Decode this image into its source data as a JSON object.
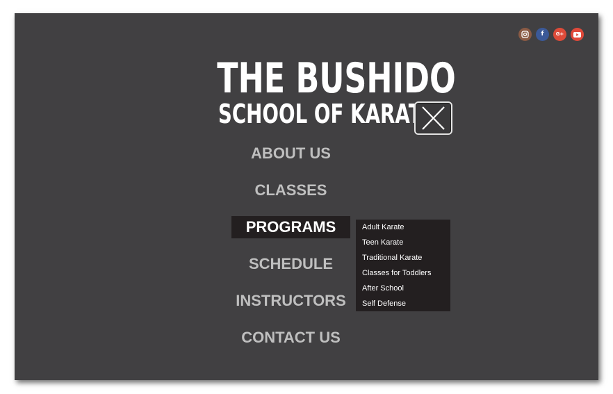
{
  "logo": {
    "line1": "THE BUSHIDO",
    "line2": "SCHOOL OF KARATE"
  },
  "social": [
    {
      "icon": "instagram-icon",
      "color": "#8a5a44",
      "glyph": ""
    },
    {
      "icon": "facebook-icon",
      "color": "#3b5998",
      "glyph": "f"
    },
    {
      "icon": "google-plus-icon",
      "color": "#dd4b39",
      "glyph": "G+"
    },
    {
      "icon": "youtube-icon",
      "color": "#e0493a",
      "glyph": ""
    }
  ],
  "close_icon": "close-icon",
  "nav": {
    "items": [
      {
        "label": "ABOUT US"
      },
      {
        "label": "CLASSES"
      },
      {
        "label": "PROGRAMS",
        "active": true
      },
      {
        "label": "SCHEDULE"
      },
      {
        "label": "INSTRUCTORS"
      },
      {
        "label": "CONTACT US"
      }
    ]
  },
  "programs_menu": {
    "items": [
      {
        "label": "Adult Karate"
      },
      {
        "label": "Teen Karate"
      },
      {
        "label": "Traditional Karate"
      },
      {
        "label": "Classes for Toddlers"
      },
      {
        "label": "After School"
      },
      {
        "label": "Self Defense"
      }
    ]
  },
  "colors": {
    "background": "#414042",
    "menu_active": "#231f20",
    "nav_text": "#bfbfbf",
    "white": "#ffffff"
  }
}
